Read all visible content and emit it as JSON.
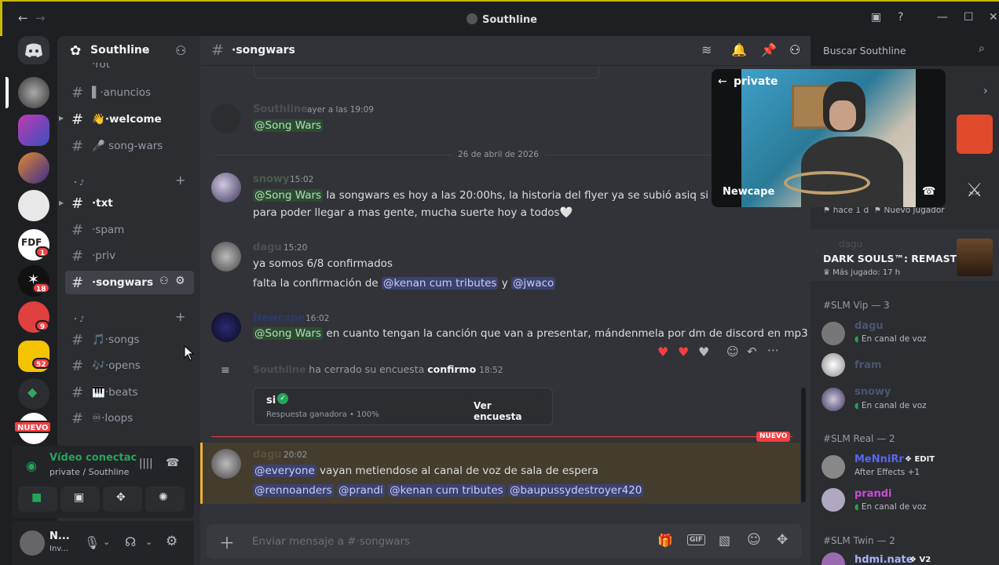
{
  "window": {
    "title": "Southline",
    "back_glyph": "←",
    "forward_glyph": "→",
    "minimize_glyph": "—",
    "maximize_glyph": "☐",
    "close_glyph": "✕"
  },
  "server": {
    "name": "Southline",
    "rail_badges": [
      "1",
      "18",
      "9",
      "52"
    ],
    "nuevo_label": "NUEVO"
  },
  "sidebar": {
    "partial_top": "·rot",
    "channels": [
      {
        "label": "·anuncios",
        "emoji": "▌"
      },
      {
        "label": "·welcome",
        "emoji": "👋"
      },
      {
        "label": "song-wars",
        "emoji": "🎤"
      },
      {
        "label": "·txt",
        "emoji": ""
      },
      {
        "label": "·spam",
        "emoji": ""
      },
      {
        "label": "·priv",
        "emoji": ""
      },
      {
        "label": "·songwars",
        "emoji": ""
      },
      {
        "label": "·songs",
        "emoji": "🎵"
      },
      {
        "label": "·opens",
        "emoji": "🎶"
      },
      {
        "label": "·beats",
        "emoji": "🎹"
      },
      {
        "label": "·loops",
        "emoji": "♾"
      }
    ],
    "category_1": "・♪",
    "category_2": "・♪"
  },
  "voice": {
    "status": "Vídeo conectac",
    "channel": "private / Southline"
  },
  "user": {
    "name": "N...",
    "status": "Inv..."
  },
  "chat": {
    "channel_name": "·songwars",
    "search_placeholder": "Buscar Southline",
    "date_divider": "26 de abril de 2026",
    "new_label": "NUEVO",
    "composer_placeholder": "Enviar mensaje a #·songwars",
    "messages": [
      {
        "author": "Southline",
        "time": "ayer a las 19:09",
        "line1_mention": "@Song Wars",
        "line1": "",
        "color": "#4a4f57"
      },
      {
        "author": "snowy",
        "time": "15:02",
        "line1_mention": "@Song Wars",
        "line1": " la songwars es hoy a las 20:00hs, la historia del flyer ya se subió asiq si pueden",
        "line2": "para poder llegar a mas gente, mucha suerte hoy a todos🤍",
        "color": "#4a5a4f"
      },
      {
        "author": "dagu",
        "time": "15:20",
        "line1": "ya somos 6/8 confirmados",
        "line2_a": "falta la confirmación de ",
        "line2_m1": "@kenan cum tributes",
        "line2_b": " y ",
        "line2_m2": "@jwaco",
        "color": "#4a4f57"
      },
      {
        "author": "Newcape",
        "time": "16:02",
        "line1_mention": "@Song Wars",
        "line1": " en cuanto tengan la canción que van a presentar, mándenmela por dm de discord en mp3",
        "color": "#2d3a6b"
      }
    ],
    "poll": {
      "author": "Southline",
      "action": " ha cerrado su encuesta ",
      "poll_name": "confirmo",
      "time": "18:52",
      "answer": "si",
      "result": "Respuesta ganadora • 100%",
      "button": "Ver encuesta"
    },
    "last_message": {
      "author": "dagu",
      "time": "20:02",
      "mention": "@everyone",
      "text": " vayan metiendose al canal de voz de sala de espera",
      "mentions": [
        "@rennoanders",
        "@prandi",
        "@kenan cum tributes",
        "@baupussydestroyer420"
      ]
    }
  },
  "video": {
    "label": "private",
    "user": "Newcape"
  },
  "right_panel": {
    "activity_time": "hace 1 d",
    "activity_badge": "Nuevo jugador",
    "game_author": "dagu",
    "game_title": "DARK SOULS™: REMASTE...",
    "game_played": "Más jugado: 17 h",
    "groups": [
      {
        "header": "#SLM Vip — 3",
        "members": [
          {
            "name": "dagu",
            "sub": "En canal de voz",
            "color": "#4a5570"
          },
          {
            "name": "fram",
            "sub": "",
            "color": "#4a5570"
          },
          {
            "name": "snowy",
            "sub": "En canal de voz",
            "color": "#4a5570"
          }
        ]
      },
      {
        "header": "#SLM Real — 2",
        "members": [
          {
            "name": "MeNniRr",
            "sub": "After Effects +1",
            "tag": "EDIT",
            "color": "#5865f2"
          },
          {
            "name": "prandi",
            "sub": "En canal de voz",
            "color": "#c74bd6"
          }
        ]
      },
      {
        "header": "#SLM Twin — 2",
        "members": [
          {
            "name": "hdmi.nate",
            "sub": "",
            "tag": "V2",
            "color": "#a7b4ff"
          }
        ]
      }
    ]
  }
}
